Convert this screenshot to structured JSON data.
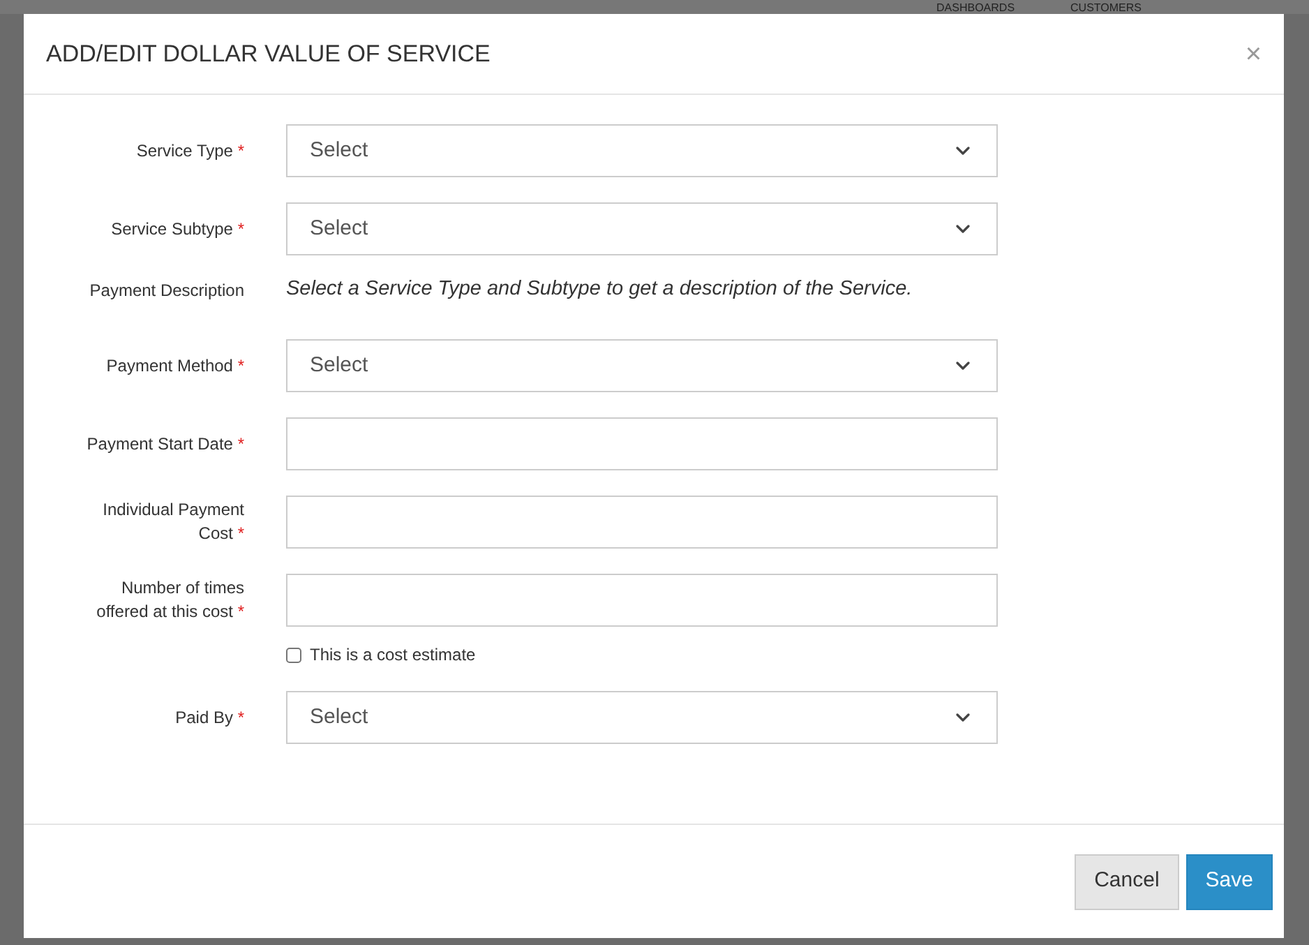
{
  "background": {
    "nav": [
      "DASHBOARDS",
      "CUSTOMERS"
    ]
  },
  "dialog": {
    "title": "ADD/EDIT DOLLAR VALUE OF SERVICE",
    "close": "×",
    "fields": [
      {
        "kind": "select",
        "label": "Service Type",
        "marker": "*",
        "value": "Select"
      },
      {
        "kind": "select",
        "label": "Service Subtype",
        "marker": "*",
        "value": "Select"
      },
      {
        "kind": "note",
        "label": "Payment Description",
        "value": "Select a Service Type and Subtype to get a description of the Service."
      },
      {
        "kind": "select",
        "label": "Payment Method",
        "marker": "*",
        "value": "Select"
      },
      {
        "kind": "text",
        "label": "Payment Start Date",
        "marker": "*"
      },
      {
        "kind": "text",
        "label": "Individual Payment Cost",
        "marker": "*"
      },
      {
        "kind": "text",
        "label": "Number of times offered at this cost",
        "marker": "*"
      },
      {
        "kind": "checkbox",
        "label": "This is a cost estimate",
        "checked": false
      },
      {
        "kind": "select",
        "label": "Paid By",
        "marker": "*",
        "value": "Select"
      }
    ],
    "buttons": [
      {
        "label": "Cancel",
        "kind": "secondary"
      },
      {
        "label": "Save",
        "kind": "primary"
      }
    ]
  }
}
